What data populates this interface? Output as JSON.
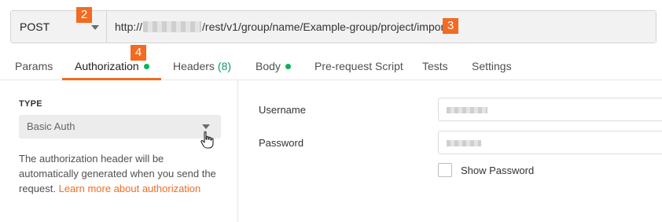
{
  "request": {
    "method": "POST",
    "url_prefix": "http://",
    "url_path": "/rest/v1/group/name/Example-group/project/import"
  },
  "badges": [
    "2",
    "3",
    "4"
  ],
  "tabs": [
    {
      "label": "Params"
    },
    {
      "label": "Authorization",
      "active": true,
      "indicator": "green-dot"
    },
    {
      "label": "Headers",
      "count": "(8)"
    },
    {
      "label": "Body",
      "indicator": "green-dot"
    },
    {
      "label": "Pre-request Script"
    },
    {
      "label": "Tests"
    },
    {
      "label": "Settings"
    }
  ],
  "auth": {
    "type_heading": "TYPE",
    "type_value": "Basic Auth",
    "description": "The authorization header will be automatically generated when you send the request. ",
    "learn_more": "Learn more about authorization"
  },
  "fields": {
    "username_label": "Username",
    "password_label": "Password",
    "show_password_label": "Show Password"
  },
  "colors": {
    "accent": "#f26b21",
    "status_green": "#0bb35a"
  }
}
